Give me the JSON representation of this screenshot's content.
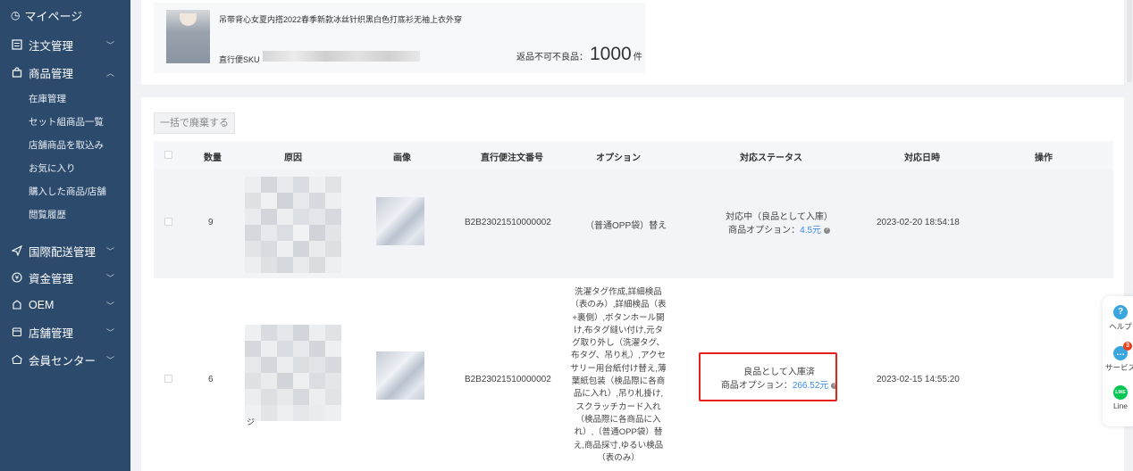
{
  "sidebar": {
    "top": "マイページ",
    "groups": [
      {
        "label": "注文管理",
        "icon": "list-icon"
      },
      {
        "label": "商品管理",
        "icon": "bag-icon"
      },
      {
        "label": "国際配送管理",
        "icon": "send-icon"
      },
      {
        "label": "資金管理",
        "icon": "money-icon"
      },
      {
        "label": "OEM",
        "icon": "oem-icon"
      },
      {
        "label": "店舗管理",
        "icon": "shop-icon"
      },
      {
        "label": "会員センター",
        "icon": "member-icon"
      }
    ],
    "sub_items": [
      "在庫管理",
      "セット組商品一覧",
      "店舗商品を取込み",
      "お気に入り",
      "購入した商品/店舗",
      "閲覧履歴"
    ]
  },
  "product": {
    "title": "吊带背心女夏内搭2022春季新款冰丝针织黑白色打底衫无袖上衣外穿",
    "sku_label": "直行便SKU",
    "return_label": "返品不可不良品：",
    "return_count": "1000",
    "return_unit": "件"
  },
  "bulk_button": "一括で廃棄する",
  "table": {
    "headers": [
      "数量",
      "原因",
      "画像",
      "直行便注文番号",
      "オプション",
      "対応ステータス",
      "対応日時",
      "操作"
    ],
    "rows": [
      {
        "qty": "9",
        "order_no": "B2B23021510000002",
        "option": "（普通OPP袋）替え",
        "status_line1": "対応中（良品として入庫）",
        "status_label": "商品オプション：",
        "status_price": "4.5元",
        "datetime": "2023-02-20 18:54:18"
      },
      {
        "qty": "6",
        "order_no": "B2B23021510000002",
        "option_lines": [
          "洗濯タグ作成,詳細検品",
          "（表のみ）,詳細検品（表",
          "+裏側）,ボタンホール開",
          "け,布タグ縫い付け,元タ",
          "グ取り外し（洗濯タグ、",
          "布タグ、吊り札）,アクセ",
          "サリー用台紙付け替え,薄",
          "葉紙包装（検品際に各商",
          "品に入れ）,吊り札掛け,",
          "スクラッチカード入れ",
          "（検品際に各商品に入",
          "れ）,（普通OPP袋）替",
          "え,商品採寸,ゆるい検品",
          "（表のみ）"
        ],
        "status_line1": "良品として入庫済",
        "status_label": "商品オプション：",
        "status_price": "266.52元",
        "datetime": "2023-02-15 14:55:20",
        "cause_char": "ジ"
      }
    ]
  },
  "float_bar": {
    "help": "ヘルプ",
    "service": "サービス",
    "service_badge": "3",
    "line": "Line",
    "line_icon_text": "LINE"
  },
  "colors": {
    "sidebar_bg": "#2b4a6c",
    "link_blue": "#3b8ce6",
    "highlight_red": "#e8201c",
    "line_green": "#06c755"
  }
}
